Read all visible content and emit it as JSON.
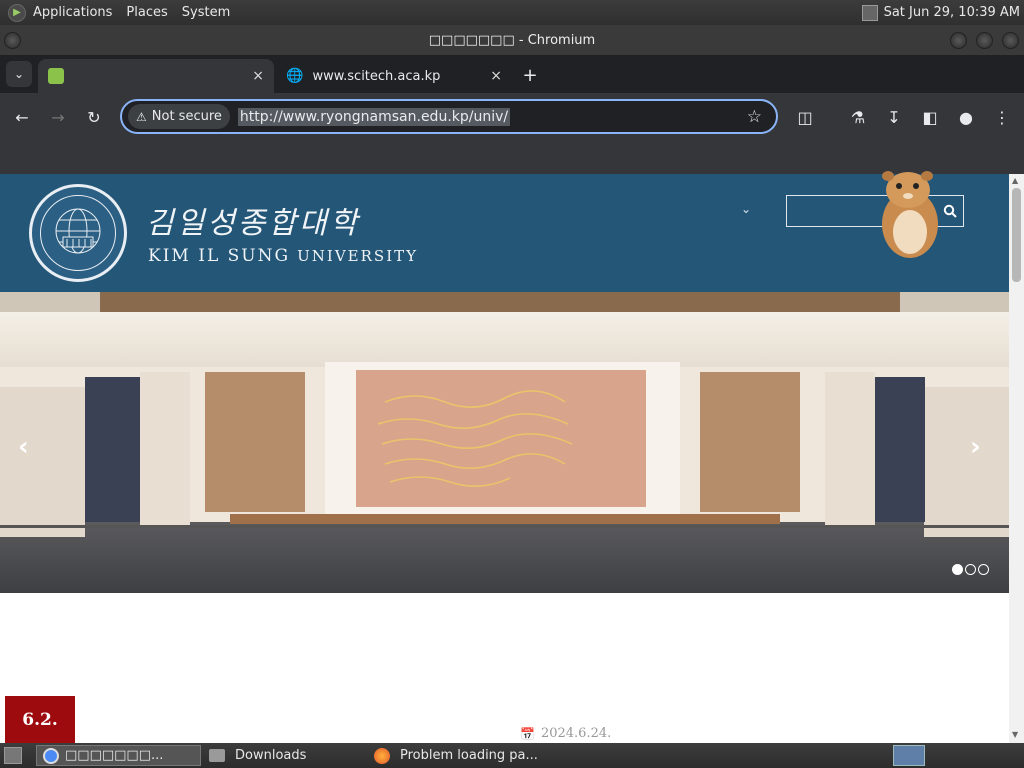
{
  "desktop": {
    "menu": [
      "Applications",
      "Places",
      "System"
    ],
    "clock": "Sat Jun 29, 10:39 AM"
  },
  "window": {
    "title": "□□□□□□□ - Chromium"
  },
  "tabs": [
    {
      "label": "",
      "close": "×"
    },
    {
      "label": "www.scitech.aca.kp",
      "close": "×"
    }
  ],
  "new_tab": "+",
  "omnibox": {
    "security_label": "Not secure",
    "url": "http://www.ryongnamsan.edu.kp/univ/"
  },
  "site": {
    "name_korean": "김일성종합대학",
    "name_english_bold": "KIM IL SUNG",
    "name_english_rest": "UNIVERSITY",
    "slider_dots": [
      true,
      false,
      false
    ],
    "article_badge": "6.2.",
    "article_date": "2024.6.24."
  },
  "taskbar": {
    "items": [
      {
        "label": "□□□□□□□..."
      },
      {
        "label": "Downloads"
      },
      {
        "label": "Problem loading pa..."
      }
    ]
  },
  "colors": {
    "header": "#245678",
    "badge": "#9e0b0f",
    "focus_ring": "#8ab4f8"
  }
}
